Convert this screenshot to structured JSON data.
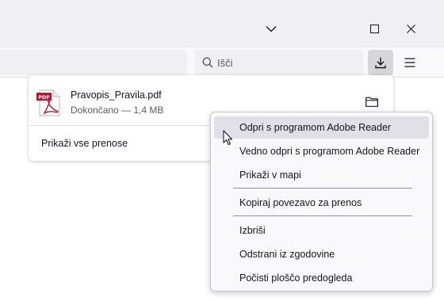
{
  "window": {
    "tabs_icon": "chevron-down-icon",
    "controls": [
      "maximize-icon",
      "close-icon"
    ]
  },
  "toolbar": {
    "search_placeholder": "Išči",
    "download_icon": "download-icon",
    "menu_icon": "hamburger-menu-icon"
  },
  "downloads": {
    "file_name": "Pravopis_Pravila.pdf",
    "status": "Dokončano — 1,4 MB",
    "pdf_badge": "PDF",
    "show_all": "Prikaži vse prenose"
  },
  "context_menu": {
    "items": [
      "Odpri s programom Adobe Reader",
      "Vedno odpri s programom Adobe Reader",
      "Prikaži v mapi",
      "Kopiraj povezavo za prenos",
      "Izbriši",
      "Odstrani iz zgodovine",
      "Počisti ploščo predogleda"
    ],
    "hovered_index": 0
  },
  "colors": {
    "accent_pdf": "#c8102e",
    "menu_hover": "#e0e0e6"
  }
}
